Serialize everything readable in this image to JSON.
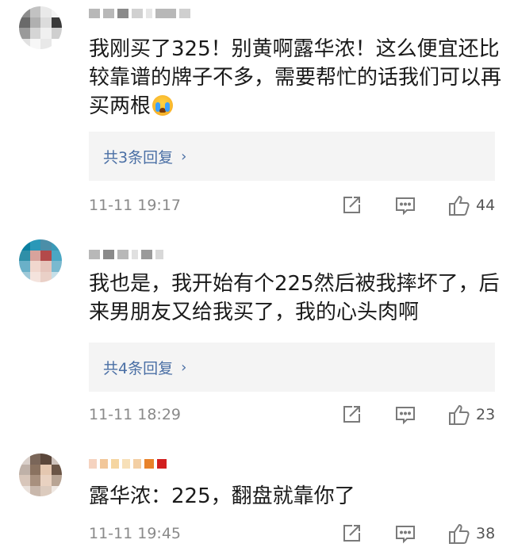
{
  "comments": [
    {
      "text": "我刚买了325！别黄啊露华浓！这么便宜还比较靠谱的牌子不多，需要帮忙的话我们可以再买两根",
      "emoji": "crying-face",
      "replies": "共3条回复",
      "time": "11-11 19:17",
      "likes": "44"
    },
    {
      "text": "我也是，我开始有个225然后被我摔坏了，后来男朋友又给我买了，我的心头肉啊",
      "replies": "共4条回复",
      "time": "11-11 18:29",
      "likes": "23"
    },
    {
      "text": "露华浓：225，翻盘就靠你了",
      "time": "11-11 19:45",
      "likes": "38"
    }
  ],
  "colors": {
    "link": "#4a6fa5",
    "meta": "#8a8a8a",
    "reply_bg": "#f4f4f4"
  },
  "icons": {
    "share": "share-icon",
    "reply": "comment-icon",
    "like": "thumbs-up-icon",
    "chevron": "chevron-right-icon"
  }
}
